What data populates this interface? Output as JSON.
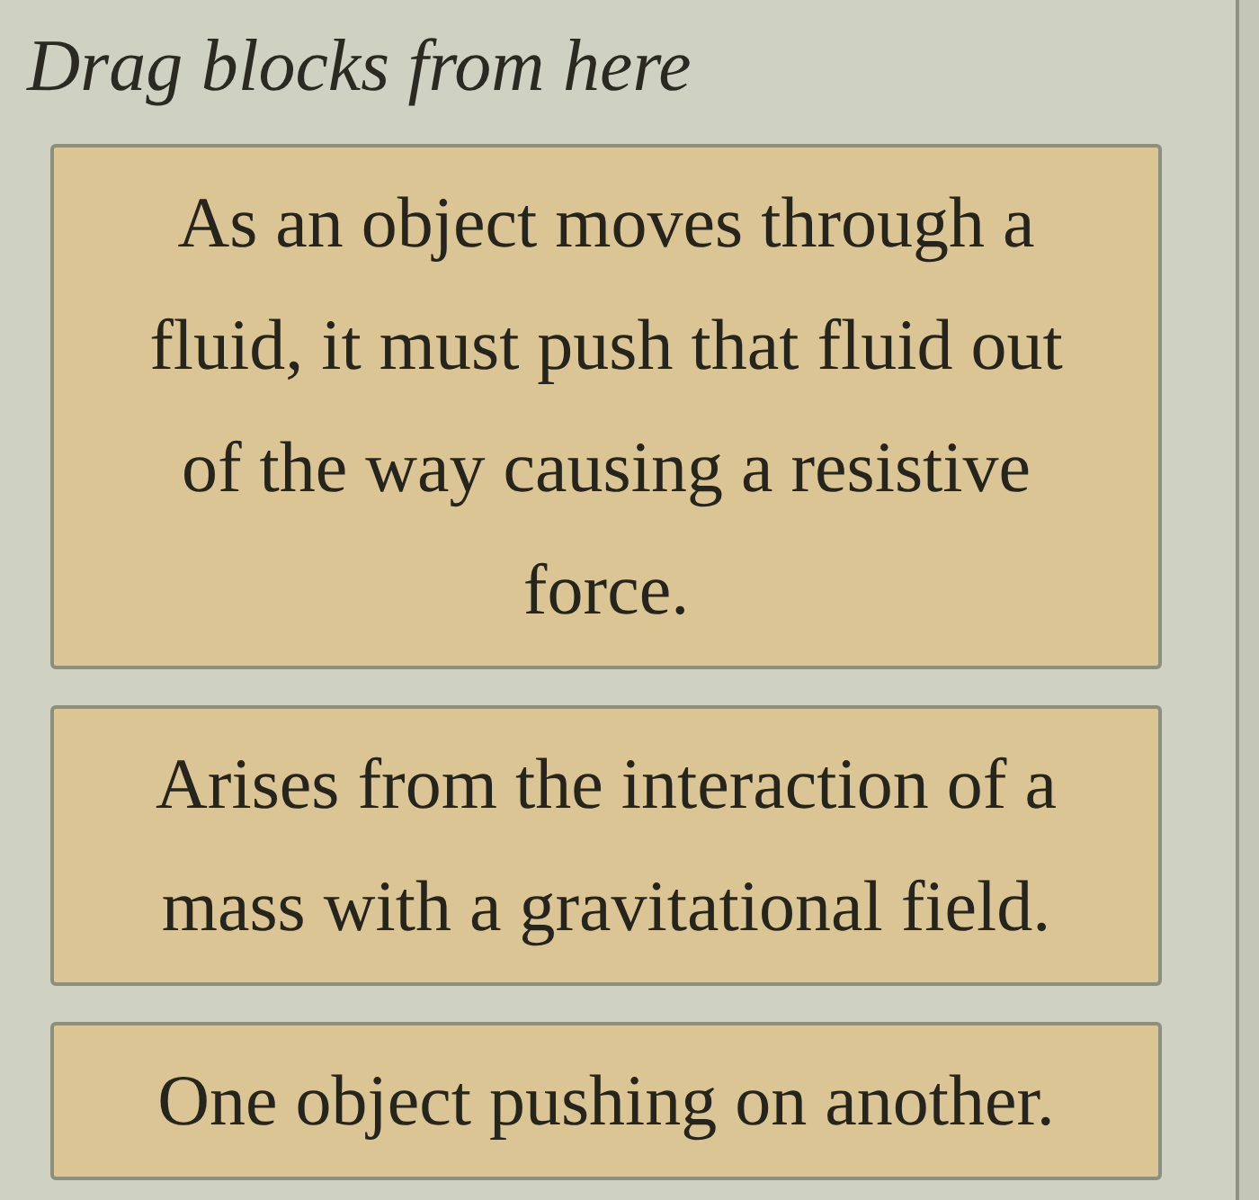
{
  "heading": "Drag blocks from here",
  "blocks": [
    {
      "text": "As an object moves through a fluid, it must push that fluid out of the way causing a resistive force."
    },
    {
      "text": "Arises from the interaction of a mass with a gravitational field."
    },
    {
      "text": "One object pushing on another."
    }
  ]
}
